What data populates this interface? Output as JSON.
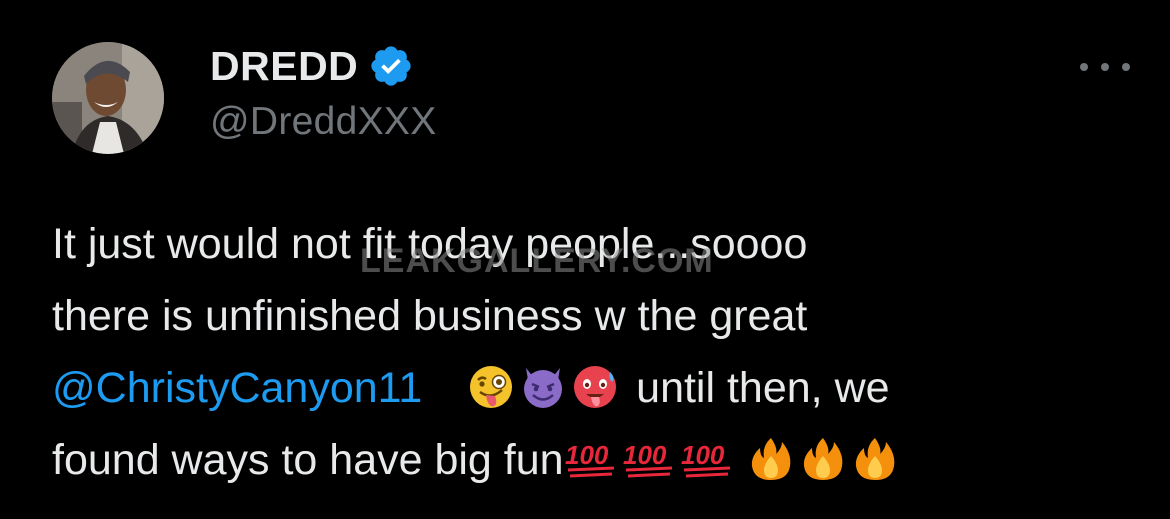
{
  "author": {
    "display_name": "DREDD",
    "handle": "@DreddXXX",
    "verified": true
  },
  "tweet": {
    "line1": "It just would not fit today people...soooo",
    "line2": "there is unfinished  business w the great",
    "mention": "@ChristyCanyon11",
    "line3_rest": "until then, we",
    "line4": "found ways to have big fun"
  },
  "emojis": [
    "winking-face-with-tongue",
    "smiling-face-with-horns",
    "hot-face",
    "hundred-points",
    "fire"
  ],
  "watermark": "LEAKGALLERY.COM",
  "colors": {
    "background": "#000000",
    "text": "#e7e9ea",
    "secondary": "#71767b",
    "mention": "#1d9bf0",
    "verified": "#1d9bf0"
  }
}
